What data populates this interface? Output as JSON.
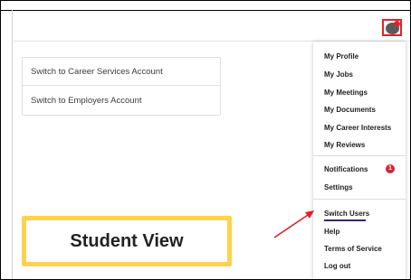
{
  "colors": {
    "accent": "#e0232a",
    "badge": "#d82331",
    "callout_border": "#ffd24d",
    "active_underline": "#2f2a6e"
  },
  "switch_card": {
    "items": [
      "Switch to Career Services Account",
      "Switch to Employers Account"
    ]
  },
  "menu": {
    "items": [
      "My Profile",
      "My Jobs",
      "My Meetings",
      "My Documents",
      "My Career Interests",
      "My Reviews",
      "Notifications",
      "Settings",
      "Switch Users",
      "Help",
      "Terms of Service",
      "Log out"
    ],
    "notifications_badge": "1"
  },
  "callout": {
    "label": "Student View"
  },
  "icons": {
    "avatar": "user-avatar-icon",
    "arrow": "annotation-arrow"
  }
}
